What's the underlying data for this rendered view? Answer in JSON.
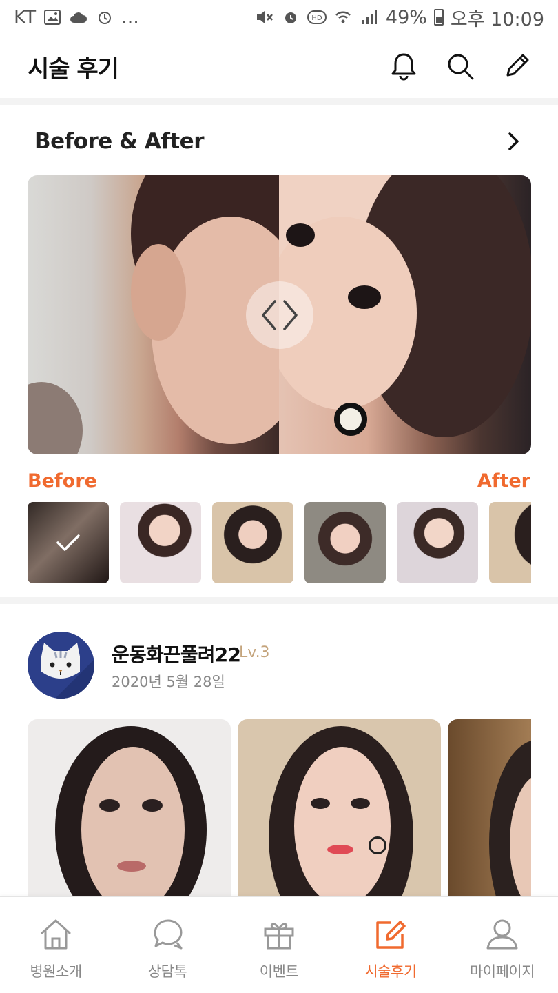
{
  "status_bar": {
    "carrier": "KT",
    "overflow": "...",
    "battery_pct": "49%",
    "time": "오후 10:09",
    "left_icons": [
      "image-icon",
      "cloud-icon",
      "alarm-icon"
    ],
    "right_icons": [
      "mute-icon",
      "alarm-icon",
      "hd-icon",
      "wifi-icon",
      "signal-icon",
      "battery-icon"
    ]
  },
  "header": {
    "title": "시술 후기",
    "actions": [
      "bell-icon",
      "search-icon",
      "pencil-icon"
    ]
  },
  "before_after": {
    "title": "Before & After",
    "before_label": "Before",
    "after_label": "After",
    "selected_thumbnail": 0,
    "thumbnail_count": 6
  },
  "review": {
    "username": "운동화끈풀려22",
    "level": "Lv.3",
    "date": "2020년 5월 28일",
    "photo_count": 3
  },
  "bottom_nav": {
    "items": [
      {
        "label": "병원소개",
        "icon": "home-icon",
        "active": false
      },
      {
        "label": "상담톡",
        "icon": "chat-icon",
        "active": false
      },
      {
        "label": "이벤트",
        "icon": "gift-icon",
        "active": false
      },
      {
        "label": "시술후기",
        "icon": "edit-icon",
        "active": true
      },
      {
        "label": "마이페이지",
        "icon": "user-icon",
        "active": false
      }
    ]
  },
  "colors": {
    "accent": "#f06a2f",
    "level": "#c4a47c",
    "nav_inactive": "#888888",
    "avatar_bg": "#2c3f8a"
  }
}
